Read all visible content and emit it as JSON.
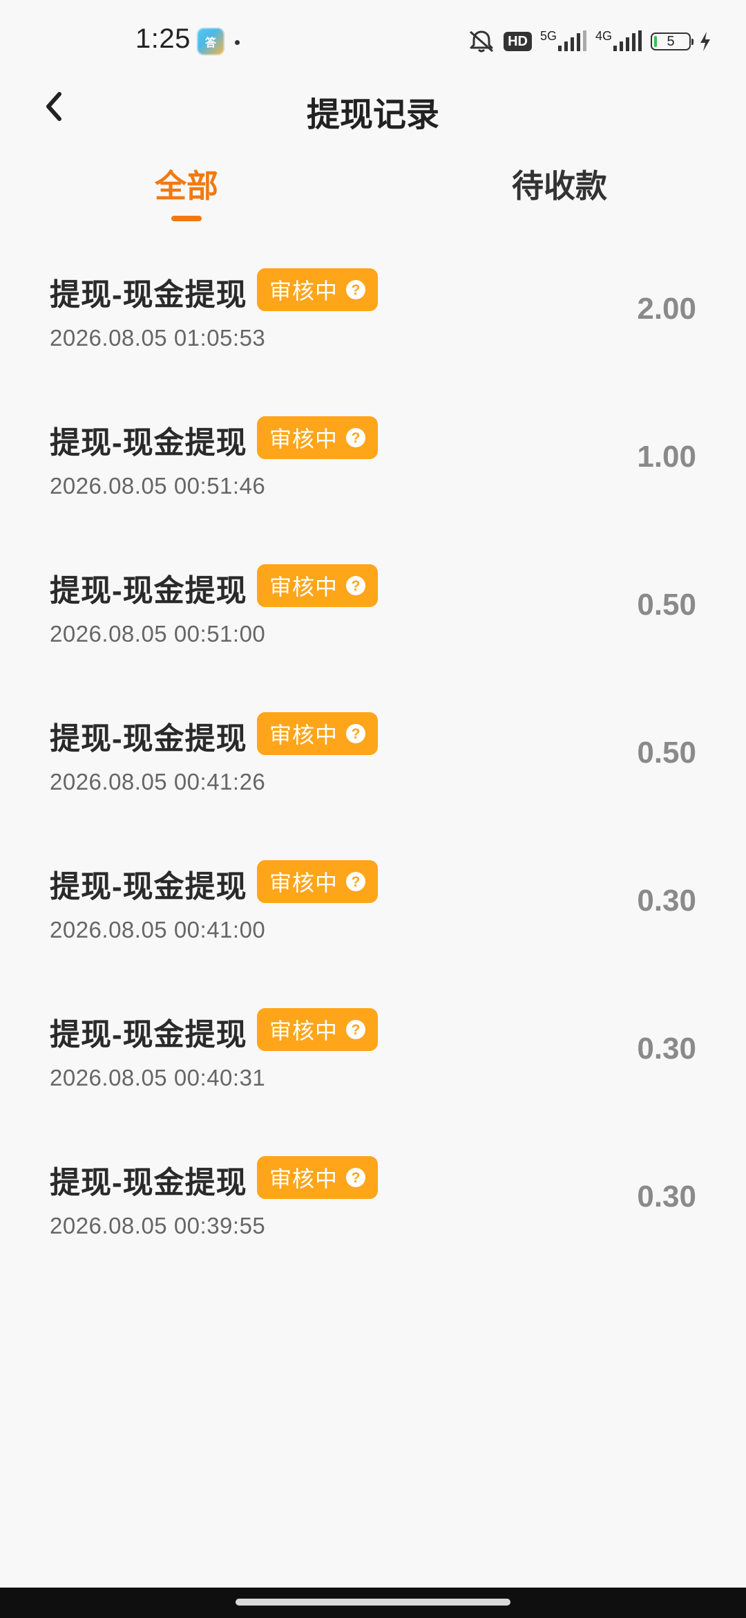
{
  "status_bar": {
    "time": "1:25",
    "app_icon_text": "答",
    "hd_label": "HD",
    "net_5g": "5G",
    "net_4g": "4G",
    "battery_level": "5",
    "colors": {
      "battery_fill": "#35c24a"
    }
  },
  "header": {
    "title": "提现记录",
    "back_icon": "chevron-left-icon"
  },
  "tabs": [
    {
      "label": "全部",
      "active": true
    },
    {
      "label": "待收款",
      "active": false
    }
  ],
  "accent_color": "#f07a12",
  "badge_color": "#fea519",
  "records": [
    {
      "title": "提现-现金提现",
      "status": "审核中",
      "time": "2026.08.05 01:05:53",
      "amount": "2.00"
    },
    {
      "title": "提现-现金提现",
      "status": "审核中",
      "time": "2026.08.05 00:51:46",
      "amount": "1.00"
    },
    {
      "title": "提现-现金提现",
      "status": "审核中",
      "time": "2026.08.05 00:51:00",
      "amount": "0.50"
    },
    {
      "title": "提现-现金提现",
      "status": "审核中",
      "time": "2026.08.05 00:41:26",
      "amount": "0.50"
    },
    {
      "title": "提现-现金提现",
      "status": "审核中",
      "time": "2026.08.05 00:41:00",
      "amount": "0.30"
    },
    {
      "title": "提现-现金提现",
      "status": "审核中",
      "time": "2026.08.05 00:40:31",
      "amount": "0.30"
    },
    {
      "title": "提现-现金提现",
      "status": "审核中",
      "time": "2026.08.05 00:39:55",
      "amount": "0.30"
    }
  ]
}
